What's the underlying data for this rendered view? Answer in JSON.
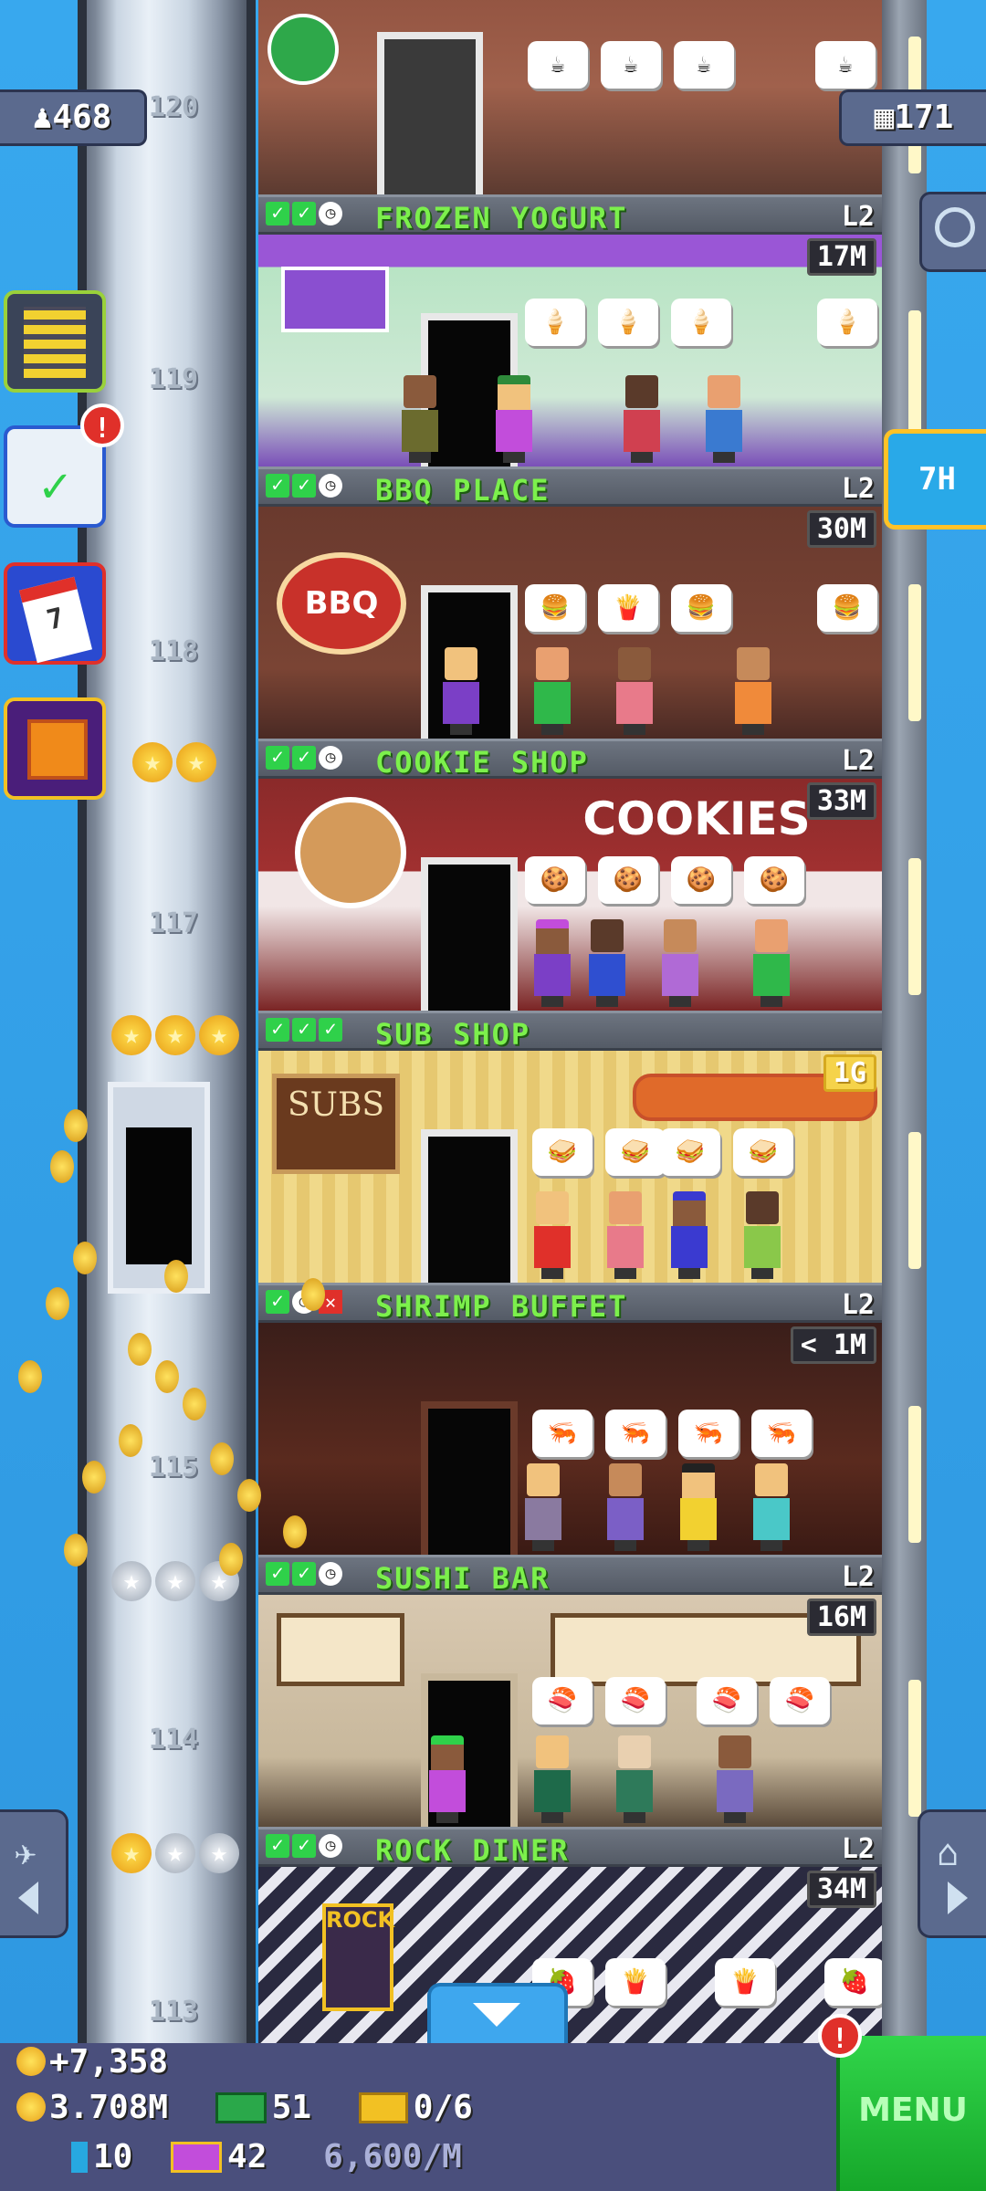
{
  "status": {
    "population": "468",
    "tower_bux": "171",
    "restock_timer": "7H"
  },
  "floors": [
    {
      "number": "120",
      "name": "FROZEN YOGURT",
      "level": "L2",
      "stock": "17M",
      "status": [
        "check",
        "check",
        "clock"
      ]
    },
    {
      "number": "119",
      "name": "BBQ PLACE",
      "level": "L2",
      "stock": "30M",
      "status": [
        "check",
        "check",
        "clock"
      ]
    },
    {
      "number": "118",
      "name": "COOKIE SHOP",
      "level": "L2",
      "stock": "33M",
      "status": [
        "check",
        "check",
        "clock"
      ],
      "sign": "BBQ"
    },
    {
      "number": "117",
      "name": "SUB SHOP",
      "level": "L2",
      "stock": "1G",
      "status": [
        "check",
        "check",
        "check"
      ],
      "sign": "COOKIES"
    },
    {
      "number": "",
      "name": "SHRIMP BUFFET",
      "level": "L2",
      "stock": "< 1M",
      "status": [
        "check",
        "clock",
        "x"
      ],
      "sign": "SUBS"
    },
    {
      "number": "115",
      "name": "SUSHI BAR",
      "level": "L2",
      "stock": "16M",
      "status": [
        "check",
        "check",
        "clock"
      ]
    },
    {
      "number": "114",
      "name": "ROCK DINER",
      "level": "L2",
      "stock": "34M",
      "status": [
        "check",
        "check",
        "clock"
      ]
    },
    {
      "number": "113",
      "name": "",
      "level": "",
      "stock": "",
      "status": [],
      "sign": "ROCK"
    }
  ],
  "icons": {
    "population": "person-icon",
    "bux": "building-icon",
    "search": "magnifier-icon",
    "build": "building-grid-icon",
    "missions": "clipboard-check-icon",
    "calendar": "calendar-icon",
    "gift": "gift-icon"
  },
  "missions_alert": "!",
  "bottom": {
    "coin_gain": "+7,358",
    "coins": "3.708M",
    "bux": "51",
    "vip": "0/6",
    "bits": "10",
    "gems": "42",
    "rate": "6,600/M",
    "menu_alert": "!",
    "menu_label": "MENU"
  },
  "colors": {
    "floor_name": "#7cf04c",
    "menu": "#16a72a",
    "sky": "#2f9ee6",
    "alert": "#e0302a"
  }
}
